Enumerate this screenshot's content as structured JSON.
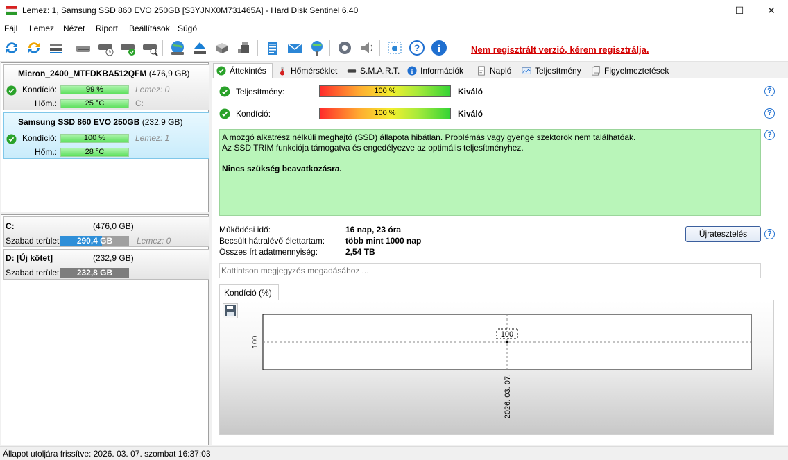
{
  "window": {
    "title": "Lemez: 1, Samsung SSD 860 EVO 250GB [S3YJNX0M731465A]  -  Hard Disk Sentinel 6.40",
    "minimize": "—",
    "maximize": "☐",
    "close": "✕"
  },
  "menu": [
    "Fájl",
    "Lemez",
    "Nézet",
    "Riport",
    "Beállítások",
    "Súgó"
  ],
  "toolbar": {
    "unregistered_notice": "Nem regisztrált verzió, kérem regisztrálja."
  },
  "disks": [
    {
      "name": "Micron_2400_MTFDKBA512QFM",
      "size": "(476,9 GB)",
      "condition_label": "Kondíció:",
      "condition_value": "99 %",
      "temp_label": "Hőm.:",
      "temp_value": "25 °C",
      "note": "Lemez: 0",
      "partition": "C:"
    },
    {
      "name": "Samsung SSD 860 EVO 250GB",
      "size": "(232,9 GB)",
      "condition_label": "Kondíció:",
      "condition_value": "100 %",
      "temp_label": "Hőm.:",
      "temp_value": "28 °C",
      "note": "Lemez: 1"
    }
  ],
  "volumes": [
    {
      "name": "C:",
      "size": "(476,0 GB)",
      "free_label": "Szabad terület",
      "free_value": "290,4 GB",
      "free_fraction": 0.61,
      "note": "Lemez: 0",
      "bar_color": "#2f8fd8"
    },
    {
      "name": "D: [Új kötet]",
      "size": "(232,9 GB)",
      "free_label": "Szabad terület",
      "free_value": "232,8 GB",
      "free_fraction": 1.0,
      "bar_color": "#7d7d7d"
    }
  ],
  "tabs": [
    "Áttekintés",
    "Hőmérséklet",
    "S.M.A.R.T.",
    "Információk",
    "Napló",
    "Teljesítmény",
    "Figyelmeztetések"
  ],
  "overview": {
    "performance_label": "Teljesítmény:",
    "performance_value": "100 %",
    "performance_rating": "Kiváló",
    "condition_label": "Kondíció:",
    "condition_value": "100 %",
    "condition_rating": "Kiváló",
    "message_line1": "A mozgó alkatrész nélküli meghajtó (SSD) állapota hibátlan. Problémás vagy gyenge szektorok nem találhatóak.",
    "message_line2": "Az SSD TRIM funkciója támogatva és engedélyezve az optimális teljesítményhez.",
    "message_bold": "Nincs szükség beavatkozásra.",
    "uptime_label": "Működési idő:",
    "uptime_value": "16 nap, 23 óra",
    "lifetime_label": "Becsült hátralévő élettartam:",
    "lifetime_value": "több mint 1000 nap",
    "written_label": "Összes írt adatmennyiség:",
    "written_value": "2,54 TB",
    "retest_button": "Újratesztelés",
    "comment_placeholder": "Kattintson megjegyzés megadásához ...",
    "chart_tab": "Kondíció  (%)"
  },
  "chart_data": {
    "type": "line",
    "x": [
      "2026. 03. 07."
    ],
    "values": [
      100
    ],
    "data_labels": [
      "100"
    ],
    "y_tick_labels": [
      "100"
    ]
  },
  "status": "Állapot utoljára frissítve: 2026. 03. 07. szombat 16:37:03",
  "colors": {
    "accent": "#1f6fd0",
    "warning": "#d40000",
    "message_bg": "#b9f5b9",
    "ok_green": "#2aa22a"
  }
}
